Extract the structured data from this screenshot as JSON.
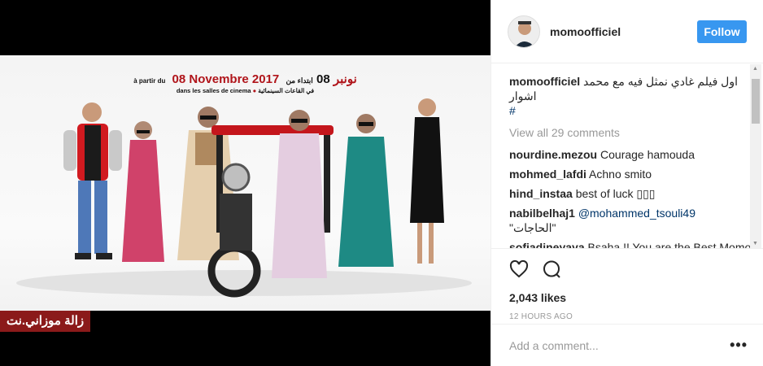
{
  "poster": {
    "line1_pre": "à partir du",
    "line1_date": "08 Novembre 2017",
    "line1_ar_red": "نونبر",
    "line1_ar_num": "08",
    "line1_ar_pre": "ابتداء من",
    "line2_fr": "dans les salles de cinema",
    "line2_ar": "في القاعات السينمائية"
  },
  "watermark": "زالة موزاني.نت",
  "header": {
    "username": "momoofficiel",
    "follow_label": "Follow"
  },
  "caption": {
    "username": "momoofficiel",
    "text": "اول فيلم غادي نمثل فيه مع محمد اشوار",
    "hashtag": "#"
  },
  "view_all": "View all 29 comments",
  "comments": [
    {
      "user": "nourdine.mezou",
      "text": "Courage hamouda"
    },
    {
      "user": "mohmed_lafdi",
      "text": "Achno smito"
    },
    {
      "user": "hind_instaa",
      "text": "best of luck ▯▯▯"
    },
    {
      "user": "nabilbelhaj1",
      "mention": "@mohammed_tsouli49",
      "text": "\"الحاجات\""
    },
    {
      "user": "sofiadineyaya",
      "text": "Bsaha !! You are the Best Momo !!!"
    }
  ],
  "likes": "2,043 likes",
  "time": "12 HOURS AGO",
  "add_comment": "Add a comment...",
  "more": "•••",
  "colors": {
    "accent": "#3897f0",
    "poster_red": "#b0141a",
    "watermark_bg": "#8b1a1a"
  },
  "icons": [
    "heart-icon",
    "comment-icon",
    "more-icon",
    "avatar"
  ]
}
